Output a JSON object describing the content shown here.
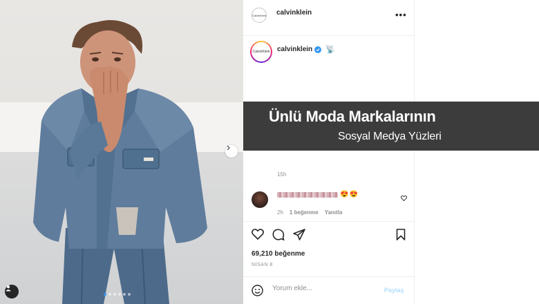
{
  "post": {
    "username": "calvinklein",
    "avatar_text": "CalvinKlein",
    "more_icon": "more-horizontal-icon",
    "caption_emoji": "📡",
    "time": "15h",
    "likes": "69,210 beğenme",
    "date": "NİSAN 8"
  },
  "photo": {
    "dots_total": 6,
    "active_dot": 0,
    "next_icon": "chevron-right-icon",
    "tag_icon": "user-tag-icon"
  },
  "comment": {
    "emoji": "😍😍",
    "time": "2h",
    "likes": "1 beğenme",
    "reply": "Yanıtla"
  },
  "actions": {
    "like_icon": "heart-icon",
    "comment_icon": "comment-icon",
    "share_icon": "share-icon",
    "save_icon": "bookmark-icon"
  },
  "add_comment": {
    "placeholder": "Yorum ekle...",
    "post_label": "Paylaş",
    "emoji_icon": "smiley-icon"
  },
  "banner": {
    "title": "Ünlü Moda Markalarının",
    "subtitle": "Sosyal Medya Yüzleri",
    "bg_color": "#3b3c3b"
  },
  "colors": {
    "accent": "#3897f0",
    "text": "#262626",
    "muted": "#8e8e8e",
    "post_disabled": "#b2dffc"
  }
}
